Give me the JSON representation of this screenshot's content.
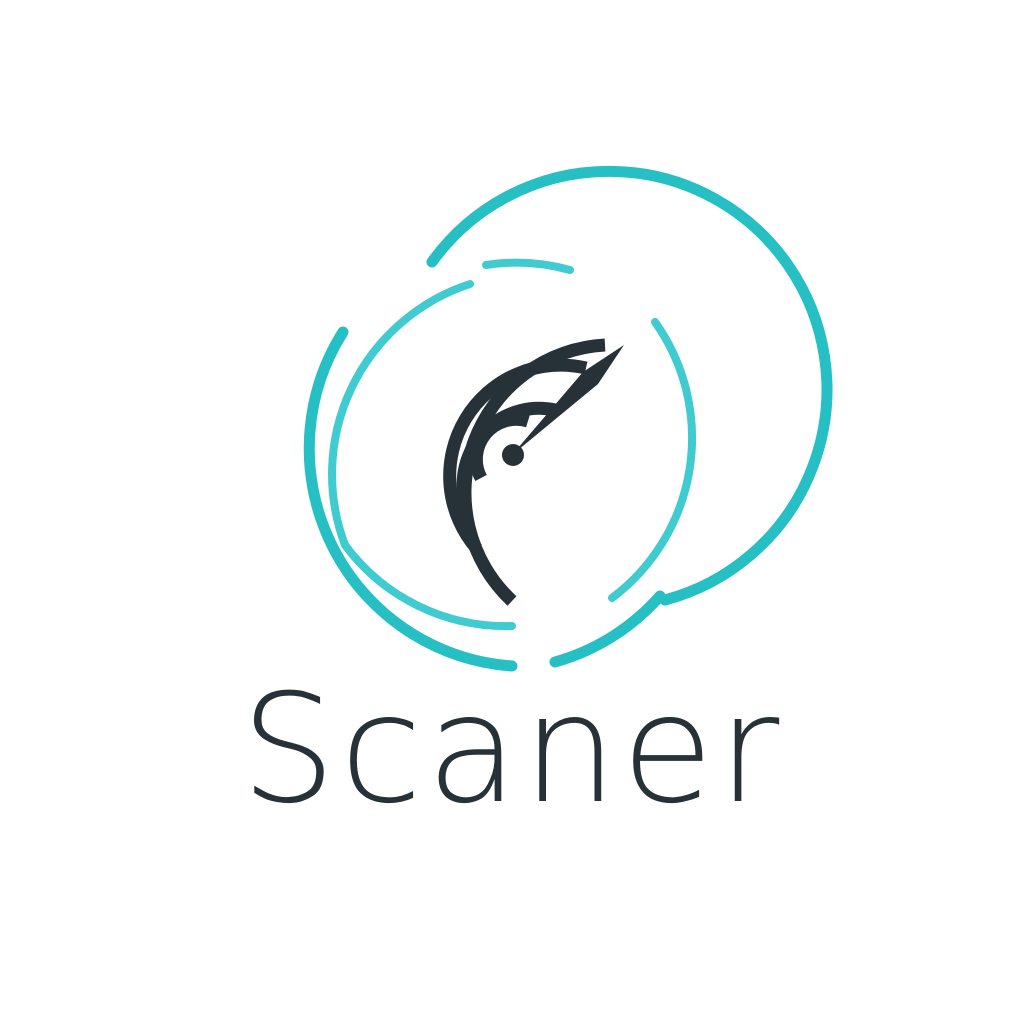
{
  "brand": {
    "name": "Scaner",
    "colors": {
      "ring": "#25bfc4",
      "ring_light": "#3fcbd0",
      "mark": "#263238",
      "background": "#ffffff"
    },
    "icon": "radar-icon"
  }
}
